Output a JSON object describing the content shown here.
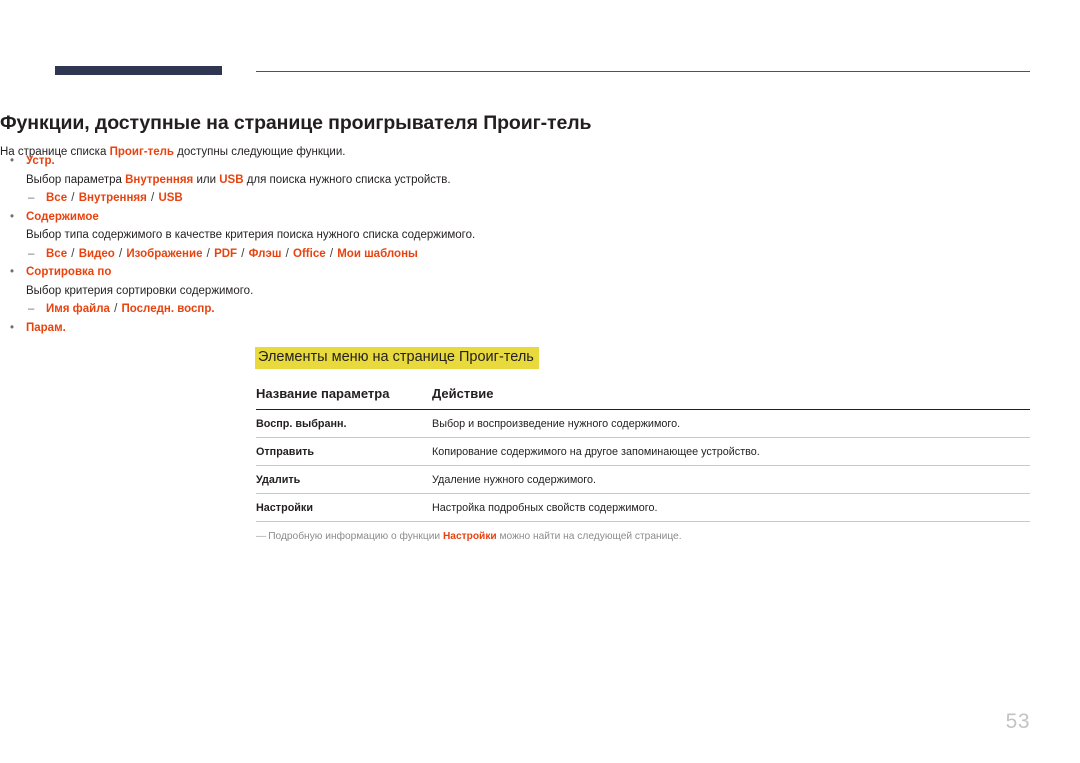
{
  "document": {
    "page_number": "53",
    "title": "Функции, доступные на странице проигрывателя Проиг-тель",
    "intro": {
      "before": "На странице списка ",
      "emphasis": "Проиг-тель",
      "after": " доступны следующие функции."
    }
  },
  "colors": {
    "accent_red": "#e8430f",
    "highlight_yellow": "#e8da3c",
    "navy_bar": "#2e3652",
    "body_text": "#231f20",
    "note_gray": "#8c8c8c",
    "page_number_gray": "#c3c3c3"
  },
  "bullets": [
    {
      "bullet_glyph": "•",
      "title": "Устр.",
      "description_parts": [
        {
          "text": "Выбор параметра ",
          "style": "plain"
        },
        {
          "text": "Внутренняя",
          "style": "red"
        },
        {
          "text": " или ",
          "style": "plain"
        },
        {
          "text": "USB",
          "style": "red"
        },
        {
          "text": " для поиска нужного списка устройств.",
          "style": "plain"
        }
      ],
      "options_dash": "–",
      "options": [
        "Все",
        "Внутренняя",
        "USB"
      ],
      "options_separator": "/"
    },
    {
      "bullet_glyph": "•",
      "title": "Содержимое",
      "description_parts": [
        {
          "text": "Выбор типа содержимого в качестве критерия поиска нужного списка содержимого.",
          "style": "plain"
        }
      ],
      "options_dash": "–",
      "options": [
        "Все",
        "Видео",
        "Изображение",
        "PDF",
        "Флэш",
        "Office",
        "Мои шаблоны"
      ],
      "options_separator": "/"
    },
    {
      "bullet_glyph": "•",
      "title": "Сортировка по",
      "description_parts": [
        {
          "text": "Выбор критерия сортировки содержимого.",
          "style": "plain"
        }
      ],
      "options_dash": "–",
      "options": [
        "Имя файла",
        "Последн. воспр."
      ],
      "options_separator": "/"
    },
    {
      "bullet_glyph": "•",
      "title": "Парам.",
      "description_parts": [],
      "options": []
    }
  ],
  "section_heading": "Элементы меню на странице Проиг-тель",
  "table": {
    "headers": [
      "Название параметра",
      "Действие"
    ],
    "rows": [
      {
        "name": "Воспр. выбранн.",
        "action": "Выбор и воспроизведение нужного содержимого."
      },
      {
        "name": "Отправить",
        "action": "Копирование содержимого на другое запоминающее устройство."
      },
      {
        "name": "Удалить",
        "action": "Удаление нужного содержимого."
      },
      {
        "name": "Настройки",
        "action": "Настройка подробных свойств содержимого."
      }
    ],
    "note": {
      "dash": "―",
      "before": "Подробную информацию о функции ",
      "emphasis": "Настройки",
      "after": " можно найти на следующей странице."
    }
  }
}
